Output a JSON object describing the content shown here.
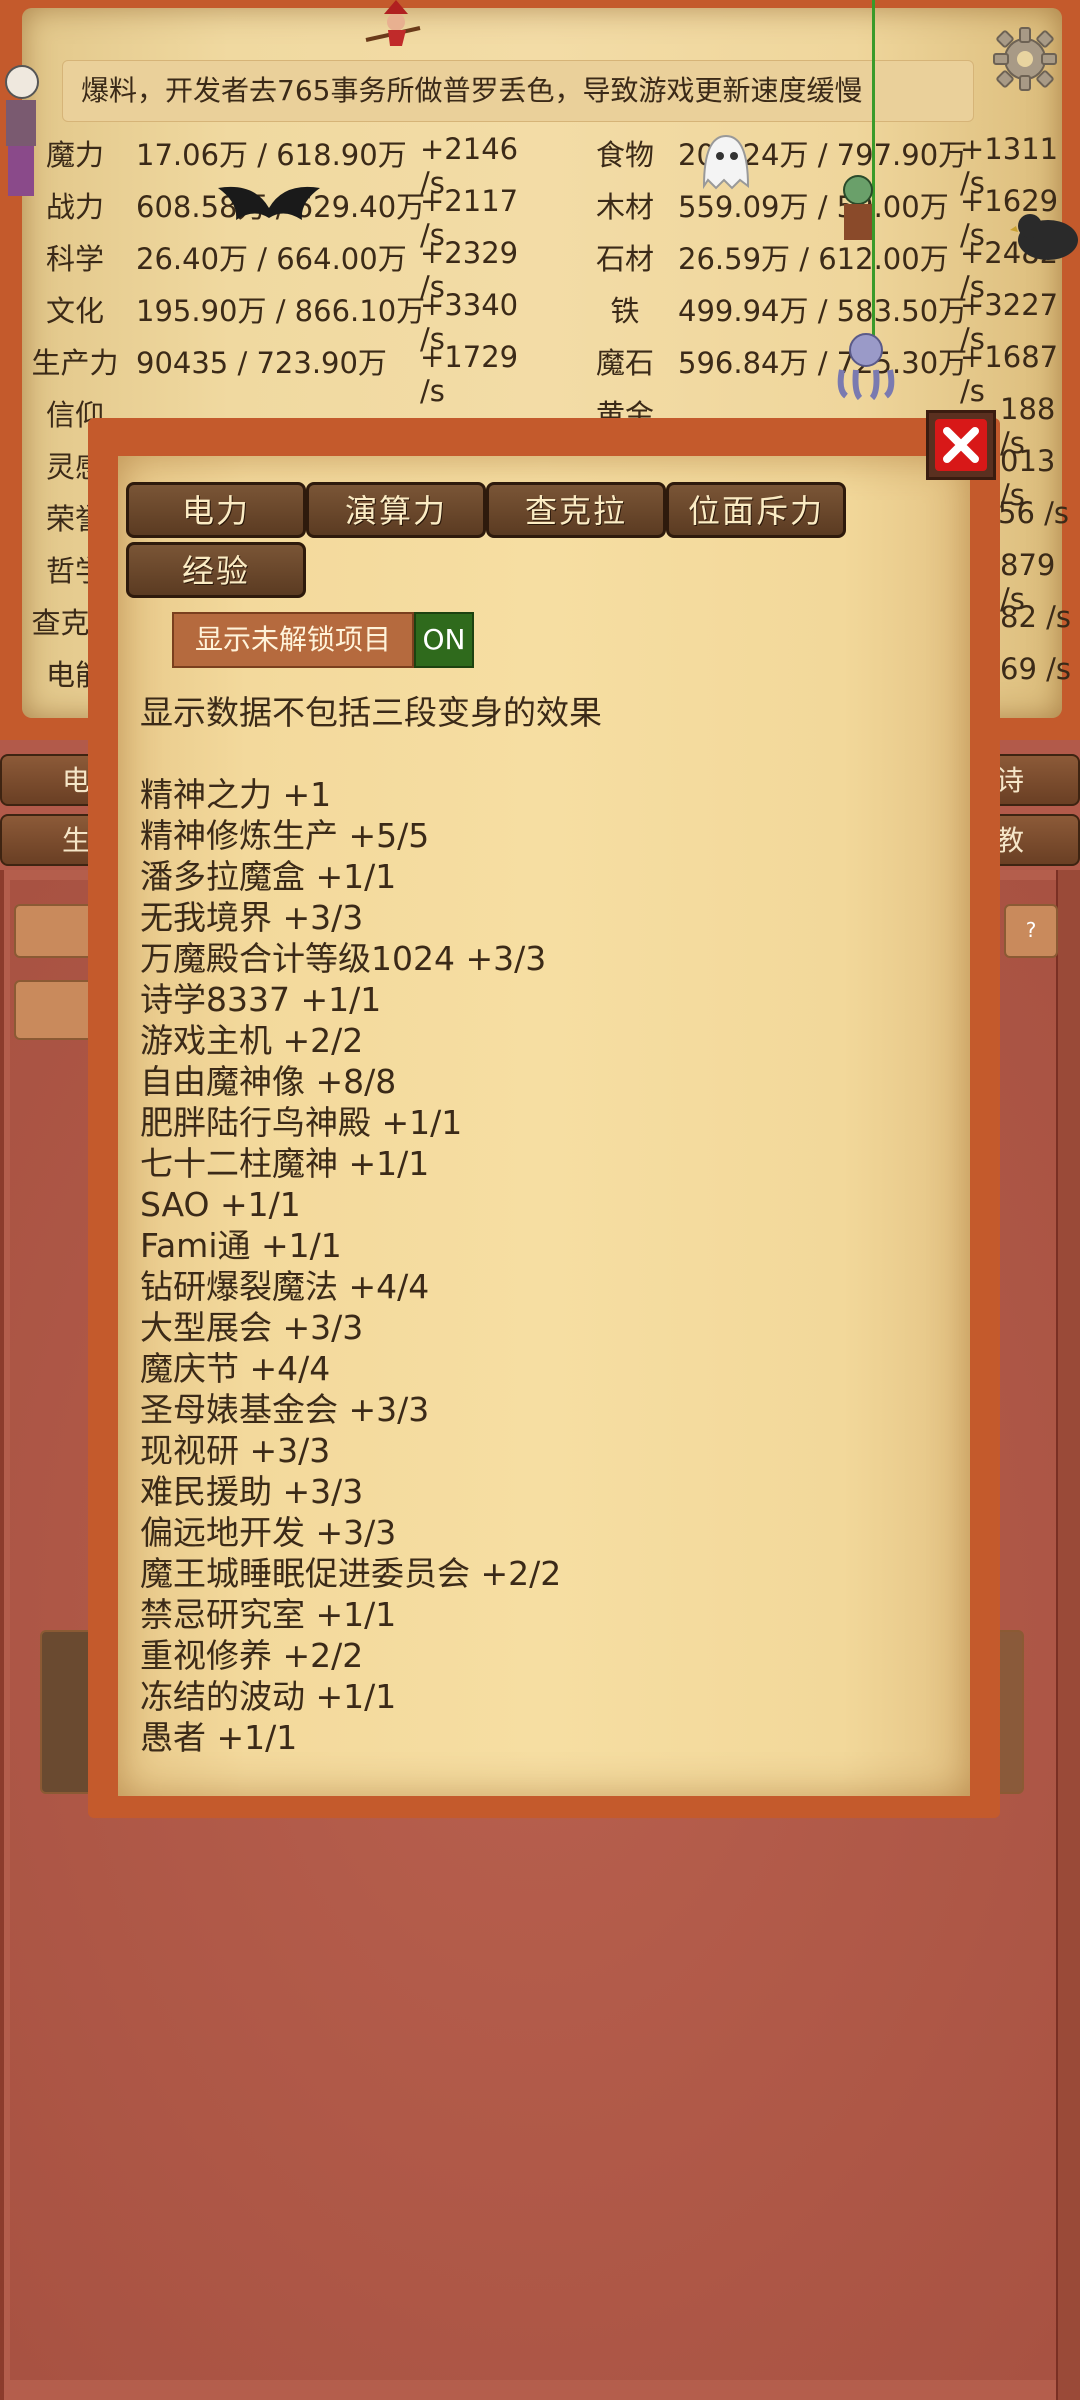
{
  "news": "爆料，开发者去765事务所做普罗丢色，导致游戏更新速度缓慢",
  "resources_left": [
    {
      "name": "魔力",
      "value": "17.06万 / 618.90万",
      "rate": "+2146 /s"
    },
    {
      "name": "战力",
      "value": "608.58万 / 629.40万",
      "rate": "+2117 /s"
    },
    {
      "name": "科学",
      "value": "26.40万 / 664.00万",
      "rate": "+2329 /s"
    },
    {
      "name": "文化",
      "value": "195.90万 / 866.10万",
      "rate": "+3340 /s"
    },
    {
      "name": "生产力",
      "value": "90435 / 723.90万",
      "rate": "+1729 /s"
    },
    {
      "name": "信仰",
      "value": "",
      "rate": ""
    },
    {
      "name": "灵感",
      "value": "",
      "rate": ""
    },
    {
      "name": "荣誉",
      "value": "",
      "rate": ""
    },
    {
      "name": "哲学",
      "value": "",
      "rate": ""
    },
    {
      "name": "查克拉",
      "value": "",
      "rate": ""
    },
    {
      "name": "电能",
      "value": "",
      "rate": ""
    }
  ],
  "resources_right": [
    {
      "name": "食物",
      "value": "203.24万 / 797.90万",
      "rate": "+1311 /s"
    },
    {
      "name": "木材",
      "value": "559.09万 / 59.00万",
      "rate": "+1629 /s"
    },
    {
      "name": "石材",
      "value": "26.59万 / 612.00万",
      "rate": "+2482 /s"
    },
    {
      "name": "铁",
      "value": "499.94万 / 583.50万",
      "rate": "+3227 /s"
    },
    {
      "name": "魔石",
      "value": "596.84万 / 725.30万",
      "rate": "+1687 /s"
    },
    {
      "name": "黄金",
      "value": "",
      "rate": "188 /s"
    },
    {
      "name": "",
      "value": "",
      "rate": "013 /s"
    },
    {
      "name": "",
      "value": "",
      "rate": "56 /s"
    },
    {
      "name": "",
      "value": "",
      "rate": "879 /s"
    },
    {
      "name": "",
      "value": "",
      "rate": "82 /s"
    },
    {
      "name": "",
      "value": "",
      "rate": "69 /s"
    }
  ],
  "side_buttons": {
    "left1": "电",
    "left2": "生",
    "right1": "诗",
    "right2": "教"
  },
  "lower_help": "?",
  "modal": {
    "tabs": [
      "电力",
      "演算力",
      "查克拉",
      "位面斥力",
      "经验"
    ],
    "toggle_label": "显示未解锁项目",
    "toggle_state": "ON",
    "note": "显示数据不包括三段变身的效果",
    "items": [
      "精神之力 +1",
      "精神修炼生产 +5/5",
      "潘多拉魔盒 +1/1",
      "无我境界 +3/3",
      "万魔殿合计等级1024 +3/3",
      "诗学8337 +1/1",
      "游戏主机 +2/2",
      "自由魔神像 +8/8",
      "肥胖陆行鸟神殿 +1/1",
      "七十二柱魔神 +1/1",
      "SAO +1/1",
      "Fami通 +1/1",
      "钻研爆裂魔法 +4/4",
      "大型展会 +3/3",
      "魔庆节 +4/4",
      "圣母婊基金会 +3/3",
      "现视研 +3/3",
      "难民援助 +3/3",
      "偏远地开发 +3/3",
      "魔王城睡眠促进委员会 +2/2",
      "禁忌研究室 +1/1",
      "重视修养 +2/2",
      "冻结的波动 +1/1",
      "愚者 +1/1"
    ]
  },
  "colors": {
    "accent": "#c45a2c",
    "close": "#d81818",
    "toggle_on": "#2f6a1c"
  }
}
